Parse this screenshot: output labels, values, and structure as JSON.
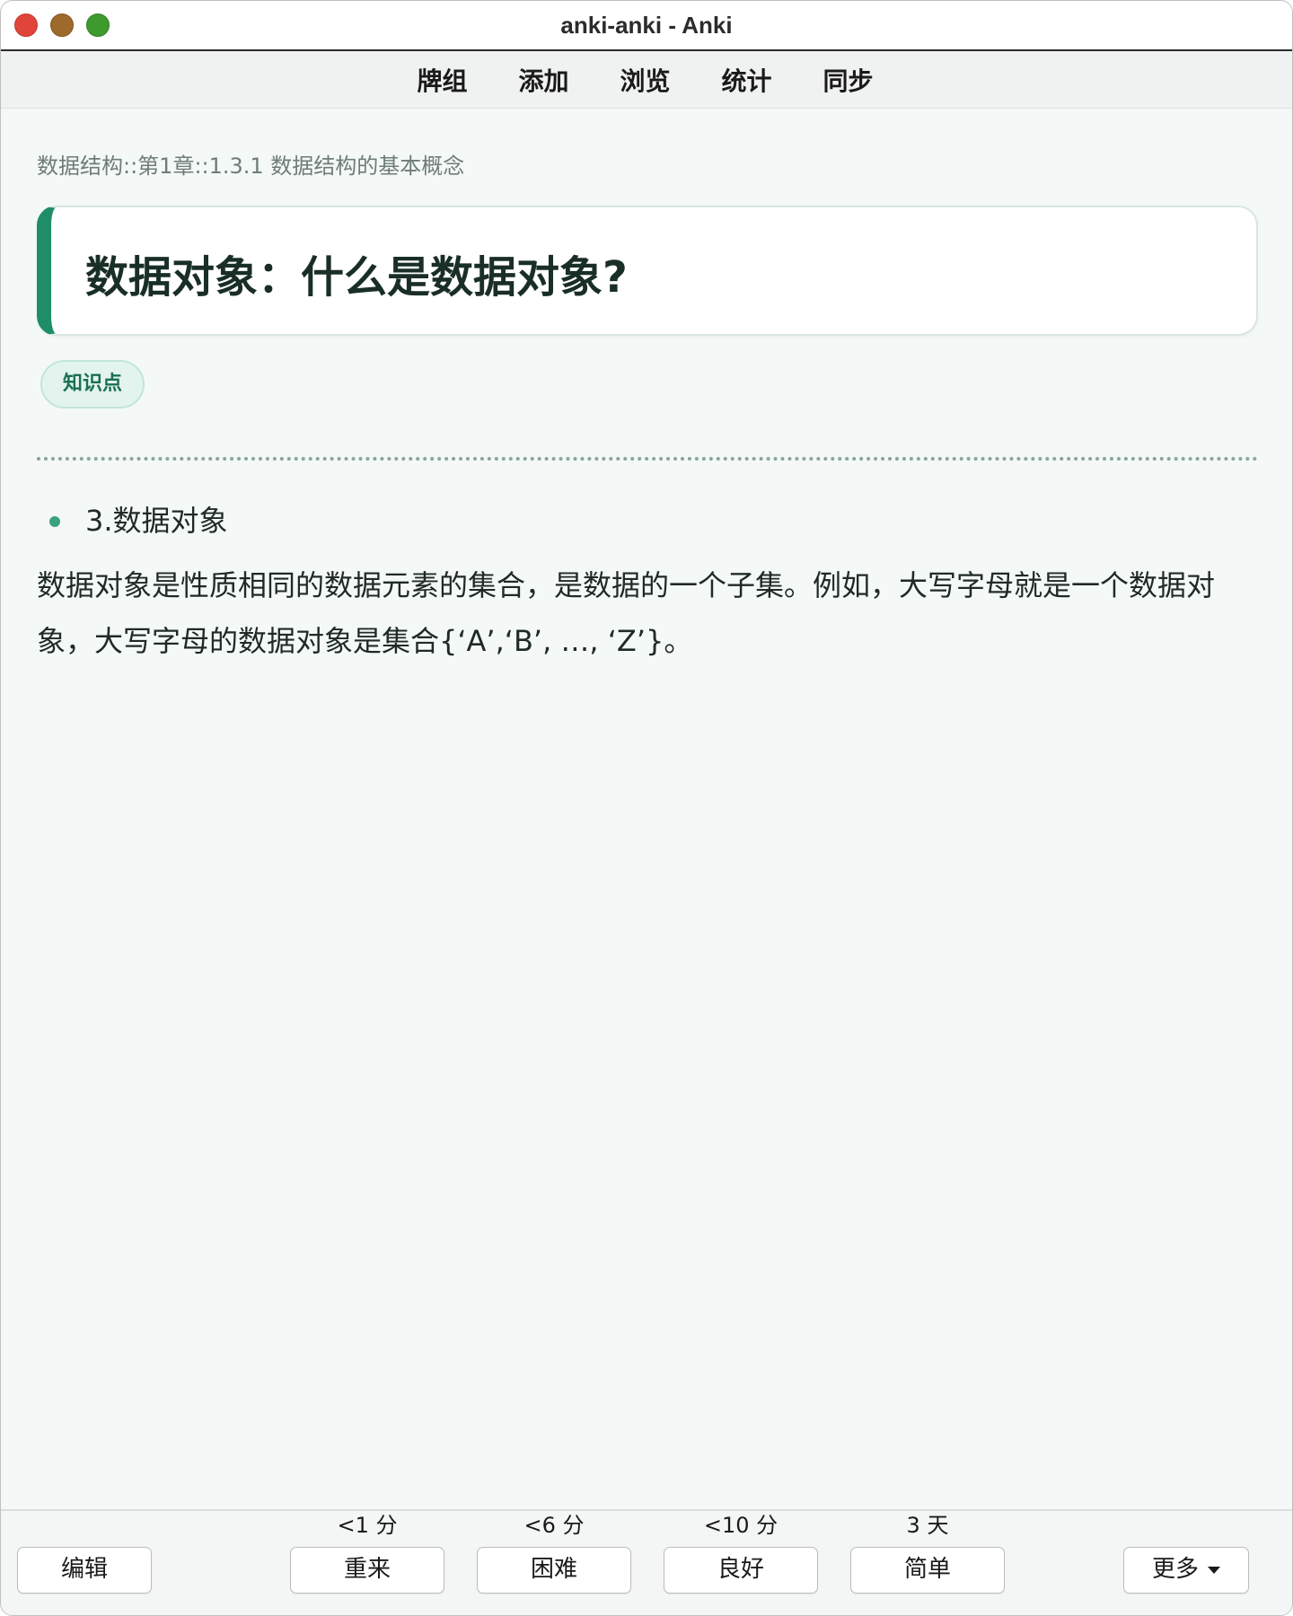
{
  "window": {
    "title": "anki-anki - Anki"
  },
  "toolbar": {
    "items": [
      {
        "label": "牌组"
      },
      {
        "label": "添加"
      },
      {
        "label": "浏览"
      },
      {
        "label": "统计"
      },
      {
        "label": "同步"
      }
    ]
  },
  "card": {
    "breadcrumb": "数据结构::第1章::1.3.1 数据结构的基本概念",
    "question": "数据对象：什么是数据对象?",
    "tag": "知识点",
    "bullet": "3.数据对象",
    "answer": "数据对象是性质相同的数据元素的集合，是数据的一个子集。例如，大写字母就是一个数据对象，大写字母的数据对象是集合{‘A’,‘B’, …, ‘Z’}。"
  },
  "bottom": {
    "edit_label": "编辑",
    "more_label": "更多",
    "answers": [
      {
        "interval": "<1 分",
        "label": "重来"
      },
      {
        "interval": "<6 分",
        "label": "困难"
      },
      {
        "interval": "<10 分",
        "label": "良好"
      },
      {
        "interval": "3 天",
        "label": "简单"
      }
    ]
  },
  "colors": {
    "accent": "#1f8c6a",
    "bullet": "#3aa37e",
    "tag_bg": "#e3f4ee",
    "page_bg": "#f4f8f7"
  }
}
